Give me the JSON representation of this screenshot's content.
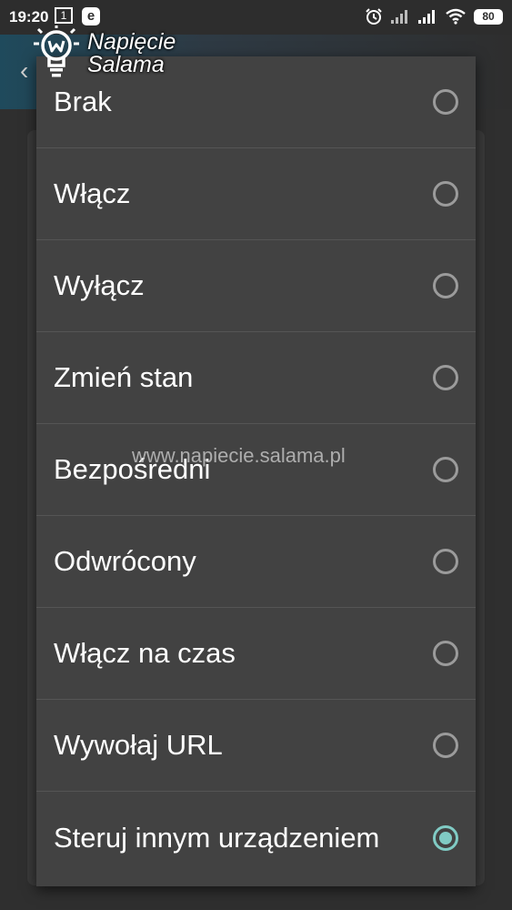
{
  "status_bar": {
    "time": "19:20",
    "calendar_day": "1",
    "notification_letter": "e",
    "battery_level": "80"
  },
  "logo": {
    "line1": "Napięcie",
    "line2": "Salama"
  },
  "watermark": "www.napiecie.salama.pl",
  "dialog": {
    "options": [
      {
        "label": "Brak",
        "selected": false
      },
      {
        "label": "Włącz",
        "selected": false
      },
      {
        "label": "Wyłącz",
        "selected": false
      },
      {
        "label": "Zmień stan",
        "selected": false
      },
      {
        "label": "Bezpośredni",
        "selected": false
      },
      {
        "label": "Odwrócony",
        "selected": false
      },
      {
        "label": "Włącz na czas",
        "selected": false
      },
      {
        "label": "Wywołaj URL",
        "selected": false
      },
      {
        "label": "Steruj innym urządzeniem",
        "selected": true
      }
    ]
  },
  "colors": {
    "accent": "#80cbc4",
    "dialog_bg": "#424242",
    "divider": "#555555"
  }
}
